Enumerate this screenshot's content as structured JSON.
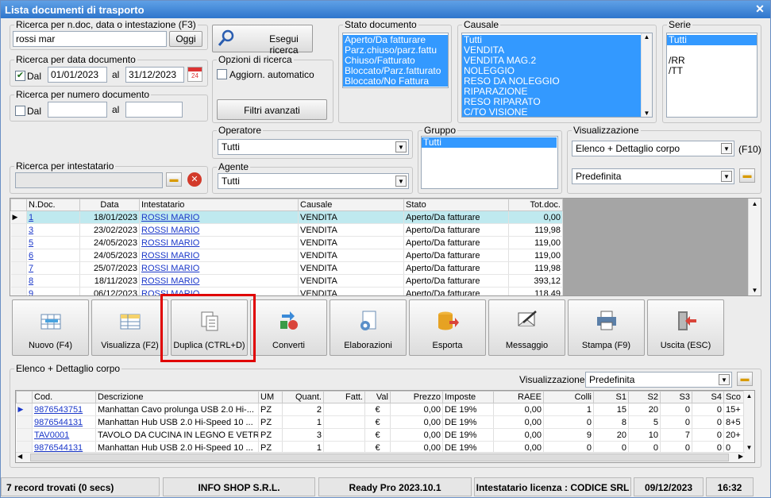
{
  "window": {
    "title": "Lista documenti di trasporto"
  },
  "search_ndoc": {
    "label": "Ricerca per n.doc, data o intestazione (F3)",
    "value": "rossi mar",
    "oggi_label": "Oggi"
  },
  "esegui": {
    "label": "Esegui ricerca"
  },
  "search_data": {
    "label": "Ricerca per data documento",
    "dal_label": "Dal",
    "dal_checked": true,
    "from": "01/01/2023",
    "al_label": "al",
    "to": "31/12/2023",
    "cal_day": "24"
  },
  "opzioni": {
    "label": "Opzioni di ricerca",
    "aggiorn_label": "Aggiorn. automatico",
    "filtri_label": "Filtri avanzati"
  },
  "search_numero": {
    "label": "Ricerca per numero documento",
    "dal_label": "Dal",
    "al_label": "al"
  },
  "stato_doc": {
    "label": "Stato documento",
    "items": [
      "Aperto/Da fatturare",
      "Parz.chiuso/parz.fattu",
      "Chiuso/Fatturato",
      "Bloccato/Parz.fatturato",
      "Bloccato/No Fattura"
    ]
  },
  "causale": {
    "label": "Causale",
    "items": [
      "Tutti",
      "VENDITA",
      "VENDITA MAG.2",
      "NOLEGGIO",
      "RESO DA NOLEGGIO",
      "RIPARAZIONE",
      "RESO RIPARATO",
      "C/TO VISIONE"
    ]
  },
  "serie": {
    "label": "Serie",
    "items": [
      "Tutti",
      "",
      "/RR",
      "/TT"
    ]
  },
  "operatore": {
    "label": "Operatore",
    "value": "Tutti"
  },
  "gruppo": {
    "label": "Gruppo",
    "items": [
      "Tutti"
    ]
  },
  "visualizzazione": {
    "label": "Visualizzazione",
    "value": "Elenco + Dettaglio corpo",
    "shortcut": "(F10)",
    "preset": "Predefinita"
  },
  "intestatario": {
    "label": "Ricerca per intestatario"
  },
  "agente": {
    "label": "Agente",
    "value": "Tutti"
  },
  "doc_table": {
    "headers": [
      "N.Doc.",
      "Data",
      "Intestatario",
      "Causale",
      "Stato",
      "Tot.doc."
    ],
    "rows": [
      [
        "1",
        "18/01/2023",
        "ROSSI MARIO",
        "VENDITA",
        "Aperto/Da fatturare",
        "0,00"
      ],
      [
        "3",
        "23/02/2023",
        "ROSSI MARIO",
        "VENDITA",
        "Aperto/Da fatturare",
        "119,98"
      ],
      [
        "5",
        "24/05/2023",
        "ROSSI MARIO",
        "VENDITA",
        "Aperto/Da fatturare",
        "119,00"
      ],
      [
        "6",
        "24/05/2023",
        "ROSSI MARIO",
        "VENDITA",
        "Aperto/Da fatturare",
        "119,00"
      ],
      [
        "7",
        "25/07/2023",
        "ROSSI MARIO",
        "VENDITA",
        "Aperto/Da fatturare",
        "119,98"
      ],
      [
        "8",
        "18/11/2023",
        "ROSSI MARIO",
        "VENDITA",
        "Aperto/Da fatturare",
        "393,12"
      ],
      [
        "9",
        "06/12/2023",
        "ROSSI MARIO",
        "VENDITA",
        "Aperto/Da fatturare",
        "118,49"
      ]
    ]
  },
  "toolbar": [
    {
      "name": "nuovo-button",
      "label": "Nuovo (F4)",
      "icon": "new-grid-icon"
    },
    {
      "name": "visualizza-button",
      "label": "Visualizza (F2)",
      "icon": "view-grid-icon"
    },
    {
      "name": "duplica-button",
      "label": "Duplica (CTRL+D)",
      "icon": "copy-icon"
    },
    {
      "name": "converti-button",
      "label": "Converti",
      "icon": "convert-icon"
    },
    {
      "name": "elaborazioni-button",
      "label": "Elaborazioni",
      "icon": "gear-doc-icon"
    },
    {
      "name": "esporta-button",
      "label": "Esporta",
      "icon": "export-icon"
    },
    {
      "name": "messaggio-button",
      "label": "Messaggio",
      "icon": "message-icon"
    },
    {
      "name": "stampa-button",
      "label": "Stampa (F9)",
      "icon": "printer-icon"
    },
    {
      "name": "uscita-button",
      "label": "Uscita (ESC)",
      "icon": "exit-icon"
    }
  ],
  "highlight_color": "#e00000",
  "detail": {
    "label": "Elenco + Dettaglio corpo",
    "vis_label": "Visualizzazione :",
    "vis_value": "Predefinita",
    "headers": [
      "Cod.",
      "Descrizione",
      "UM",
      "Quant.",
      "Fatt.",
      "Val",
      "Prezzo",
      "Imposte",
      "RAEE",
      "Colli",
      "S1",
      "S2",
      "S3",
      "S4",
      "Sco"
    ],
    "rows": [
      [
        "9876543751",
        "Manhattan Cavo prolunga USB 2.0 Hi-...",
        "PZ",
        "2",
        "",
        "€",
        "0,00",
        "DE 19%",
        "0,00",
        "1",
        "15",
        "20",
        "0",
        "0",
        "15+"
      ],
      [
        "9876544131",
        "Manhattan Hub USB 2.0 Hi-Speed 10 ...",
        "PZ",
        "1",
        "",
        "€",
        "0,00",
        "DE 19%",
        "0,00",
        "0",
        "8",
        "5",
        "0",
        "0",
        "8+5"
      ],
      [
        "TAV0001",
        "TAVOLO DA CUCINA IN LEGNO E VETRO",
        "PZ",
        "3",
        "",
        "€",
        "0,00",
        "DE 19%",
        "0,00",
        "9",
        "20",
        "10",
        "7",
        "0",
        "20+"
      ],
      [
        "9876544131",
        "Manhattan Hub USB 2.0 Hi-Speed 10 ...",
        "PZ",
        "1",
        "",
        "€",
        "0,00",
        "DE 19%",
        "0,00",
        "0",
        "0",
        "0",
        "0",
        "0",
        "0"
      ]
    ]
  },
  "statusbar": {
    "records": "7 record trovati (0 secs)",
    "company": "INFO SHOP S.R.L.",
    "version": "Ready Pro 2023.10.1",
    "license": "Intestatario licenza : CODICE SRL",
    "date": "09/12/2023",
    "time": "16:32"
  }
}
